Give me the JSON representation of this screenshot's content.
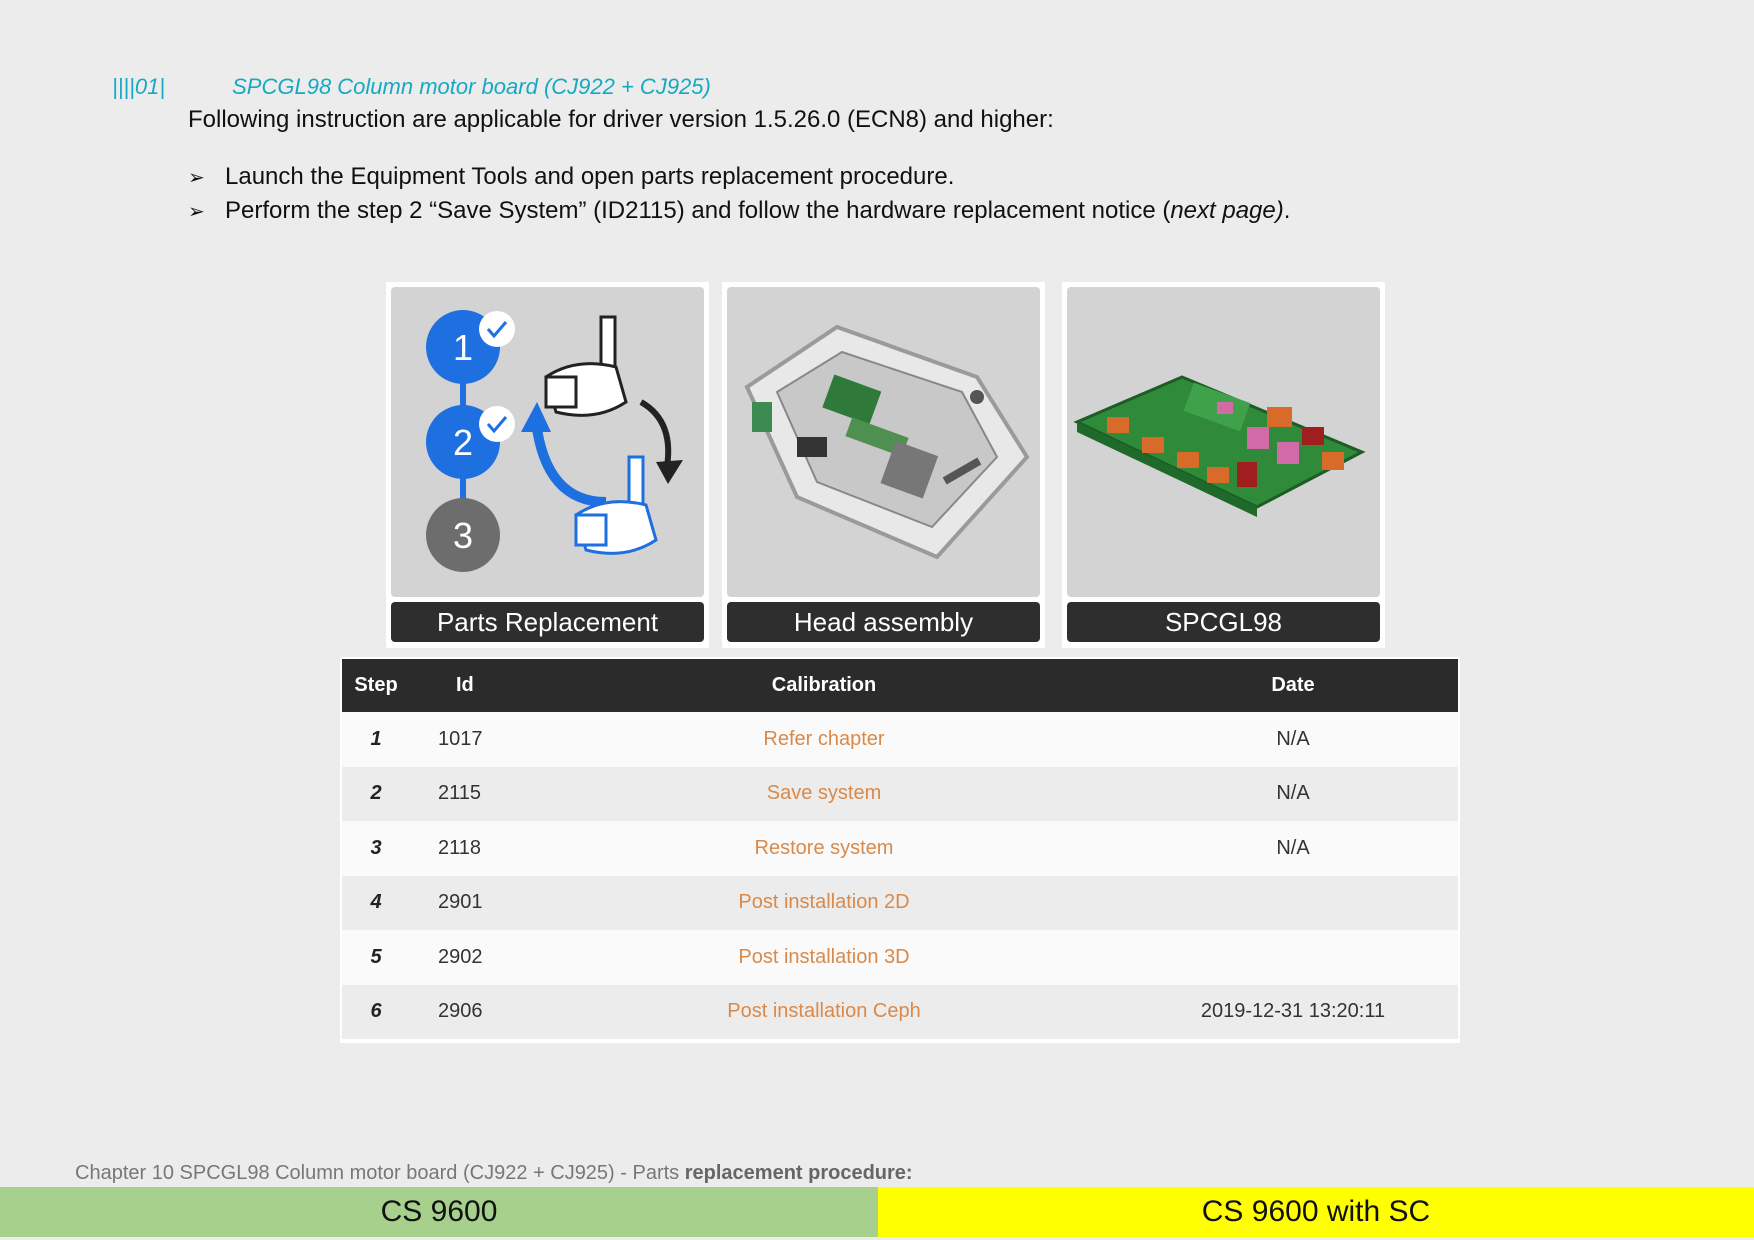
{
  "heading": {
    "number": "||||01|",
    "title": "SPCGL98 Column motor board (CJ922 + CJ925)"
  },
  "intro": "Following instruction are applicable for driver version 1.5.26.0 (ECN8) and higher:",
  "bullets": [
    {
      "arrow": "➢",
      "text": "Launch the Equipment Tools and open parts replacement procedure."
    },
    {
      "arrow": "➢",
      "text_main": "Perform the step 2 “Save System” (ID2115) and follow the hardware replacement notice (",
      "text_italic": "next page)",
      "text_end": "."
    }
  ],
  "tiles": [
    {
      "caption": "Parts Replacement",
      "steps": [
        "1",
        "2",
        "3"
      ]
    },
    {
      "caption": "Head assembly"
    },
    {
      "caption": "SPCGL98"
    }
  ],
  "table": {
    "headers": {
      "step": "Step",
      "id": "Id",
      "calibration": "Calibration",
      "date": "Date"
    },
    "rows": [
      {
        "step": "1",
        "id": "1017",
        "calibration": "Refer chapter",
        "date": "N/A"
      },
      {
        "step": "2",
        "id": "2115",
        "calibration": "Save system",
        "date": "N/A"
      },
      {
        "step": "3",
        "id": "2118",
        "calibration": "Restore system",
        "date": "N/A"
      },
      {
        "step": "4",
        "id": "2901",
        "calibration": "Post installation 2D",
        "date": ""
      },
      {
        "step": "5",
        "id": "2902",
        "calibration": "Post installation 3D",
        "date": ""
      },
      {
        "step": "6",
        "id": "2906",
        "calibration": "Post installation Ceph",
        "date": "2019-12-31 13:20:11"
      }
    ]
  },
  "footer": {
    "note_main": "Chapter 10 SPCGL98 Column motor board (CJ922 + CJ925) - Parts ",
    "note_bold": "replacement procedure:",
    "left": "CS 9600",
    "right": "CS 9600 with SC"
  },
  "colors": {
    "heading": "#17a9c4",
    "link": "#d98a4a",
    "left_bar": "#a8d08d",
    "right_bar": "#ffff00"
  }
}
